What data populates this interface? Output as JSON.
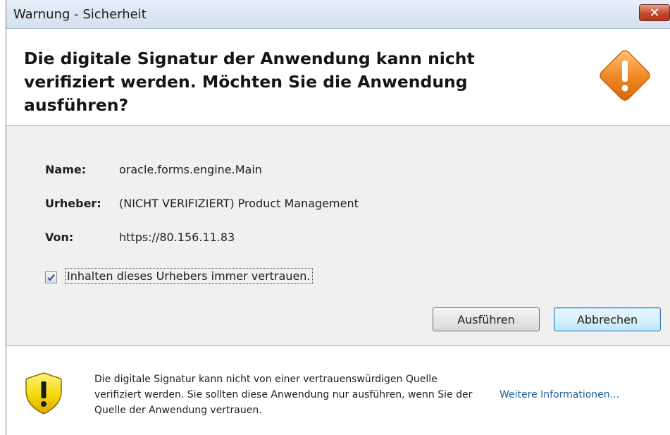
{
  "window": {
    "title": "Warnung - Sicherheit",
    "close_symbol": "✕"
  },
  "header": {
    "headline": "Die digitale Signatur der Anwendung kann nicht verifiziert werden.  Möchten Sie die Anwendung ausführen?",
    "icon": "warning-diamond-icon"
  },
  "details": {
    "name_label": "Name:",
    "name_value": "oracle.forms.engine.Main",
    "publisher_label": "Urheber:",
    "publisher_value": "(NICHT VERIFIZIERT) Product Management",
    "from_label": "Von:",
    "from_value": "https://80.156.11.83"
  },
  "trust_checkbox": {
    "label": "Inhalten dieses Urhebers immer vertrauen.",
    "checked": true
  },
  "buttons": {
    "run": "Ausführen",
    "cancel": "Abbrechen"
  },
  "footer": {
    "icon": "shield-warning-icon",
    "text": "Die digitale Signatur kann nicht von einer vertrauenswürdigen Quelle verifiziert werden. Sie sollten diese Anwendung nur ausführen, wenn Sie der Quelle der Anwendung vertrauen.",
    "more_info": "Weitere Informationen..."
  },
  "colors": {
    "warning_orange": "#f08a24",
    "shield_yellow": "#f5d90a",
    "link_blue": "#1f5e94"
  }
}
